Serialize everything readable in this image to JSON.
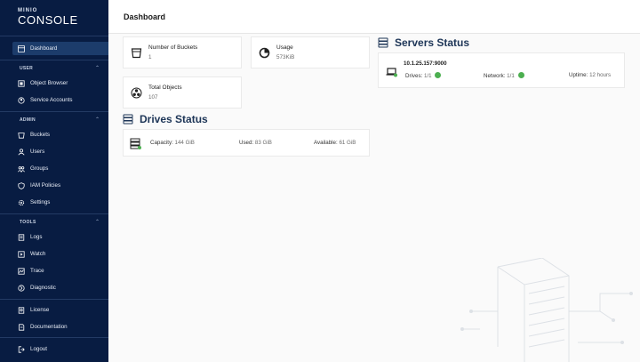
{
  "logo": {
    "mini": "MINIO",
    "main": "CONSOLE"
  },
  "sidebar": {
    "dashboard": "Dashboard",
    "user_section": "USER",
    "user_items": [
      "Object Browser",
      "Service Accounts"
    ],
    "admin_section": "ADMIN",
    "admin_items": [
      "Buckets",
      "Users",
      "Groups",
      "IAM Policies",
      "Settings"
    ],
    "tools_section": "TOOLS",
    "tools_items": [
      "Logs",
      "Watch",
      "Trace",
      "Diagnostic"
    ],
    "bottom_items": [
      "License",
      "Documentation"
    ],
    "logout": "Logout"
  },
  "header": {
    "title": "Dashboard"
  },
  "cards": {
    "buckets": {
      "label": "Number of Buckets",
      "value": "1"
    },
    "usage": {
      "label": "Usage",
      "value": "573KiB"
    },
    "objects": {
      "label": "Total Objects",
      "value": "107"
    }
  },
  "servers": {
    "title": "Servers Status",
    "host": "10.1.25.157:9000",
    "drives_label": "Drives:",
    "drives_value": "1/1",
    "network_label": "Network:",
    "network_value": "1/1",
    "uptime_label": "Uptime:",
    "uptime_value": "12 hours"
  },
  "drives": {
    "title": "Drives Status",
    "capacity_label": "Capacity:",
    "capacity_value": "144 GiB",
    "used_label": "Used:",
    "used_value": "83 GiB",
    "available_label": "Available:",
    "available_value": "61 GiB"
  },
  "colors": {
    "sidebar_bg": "#081c42",
    "accent": "#1d3557",
    "status_ok": "#4caf50"
  }
}
